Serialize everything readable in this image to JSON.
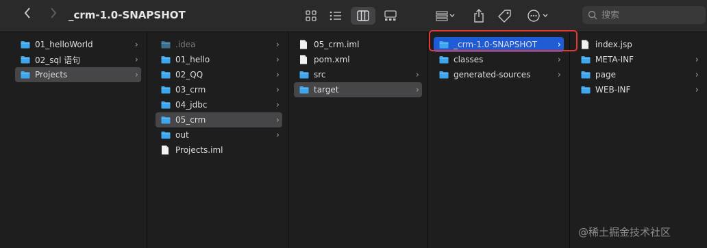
{
  "window": {
    "title": "_crm-1.0-SNAPSHOT"
  },
  "search": {
    "placeholder": "搜索"
  },
  "toolbar": {
    "back_icon": "chevron-left-icon",
    "forward_icon": "chevron-right-icon",
    "view_icons": [
      "icon-view-icon",
      "list-view-icon",
      "column-view-icon",
      "gallery-view-icon"
    ],
    "active_view": "column-view-icon",
    "group_icon": "group-icon",
    "share_icon": "share-icon",
    "tag_icon": "tag-icon",
    "more_icon": "ellipsis-circle-icon"
  },
  "columns": [
    {
      "items": [
        {
          "label": "01_helloWorld",
          "type": "folder",
          "chevron": true,
          "state": ""
        },
        {
          "label": "02_sql 语句",
          "type": "folder",
          "chevron": true,
          "state": ""
        },
        {
          "label": "Projects",
          "type": "folder",
          "chevron": true,
          "state": "gray"
        }
      ]
    },
    {
      "items": [
        {
          "label": ".idea",
          "type": "folder-dim",
          "chevron": true,
          "state": ""
        },
        {
          "label": "01_hello",
          "type": "folder",
          "chevron": true,
          "state": ""
        },
        {
          "label": "02_QQ",
          "type": "folder",
          "chevron": true,
          "state": ""
        },
        {
          "label": "03_crm",
          "type": "folder",
          "chevron": true,
          "state": ""
        },
        {
          "label": "04_jdbc",
          "type": "folder",
          "chevron": true,
          "state": ""
        },
        {
          "label": "05_crm",
          "type": "folder",
          "chevron": true,
          "state": "gray"
        },
        {
          "label": "out",
          "type": "folder",
          "chevron": true,
          "state": ""
        },
        {
          "label": "Projects.iml",
          "type": "file",
          "chevron": false,
          "state": ""
        }
      ]
    },
    {
      "items": [
        {
          "label": "05_crm.iml",
          "type": "file",
          "chevron": false,
          "state": ""
        },
        {
          "label": "pom.xml",
          "type": "file",
          "chevron": false,
          "state": ""
        },
        {
          "label": "src",
          "type": "folder",
          "chevron": true,
          "state": ""
        },
        {
          "label": "target",
          "type": "folder",
          "chevron": true,
          "state": "gray"
        }
      ]
    },
    {
      "items": [
        {
          "label": "_crm-1.0-SNAPSHOT",
          "type": "folder",
          "chevron": true,
          "state": "blue"
        },
        {
          "label": "classes",
          "type": "folder",
          "chevron": true,
          "state": ""
        },
        {
          "label": "generated-sources",
          "type": "folder",
          "chevron": true,
          "state": ""
        }
      ]
    },
    {
      "items": [
        {
          "label": "index.jsp",
          "type": "file",
          "chevron": false,
          "state": ""
        },
        {
          "label": "META-INF",
          "type": "folder",
          "chevron": true,
          "state": ""
        },
        {
          "label": "page",
          "type": "folder",
          "chevron": true,
          "state": ""
        },
        {
          "label": "WEB-INF",
          "type": "folder",
          "chevron": true,
          "state": ""
        }
      ]
    }
  ],
  "watermark": "@稀土掘金技术社区",
  "colors": {
    "folder": "#3ea6ec",
    "selection_blue": "#1f5bd5",
    "selection_gray": "#464648",
    "highlight": "#e33a33"
  }
}
